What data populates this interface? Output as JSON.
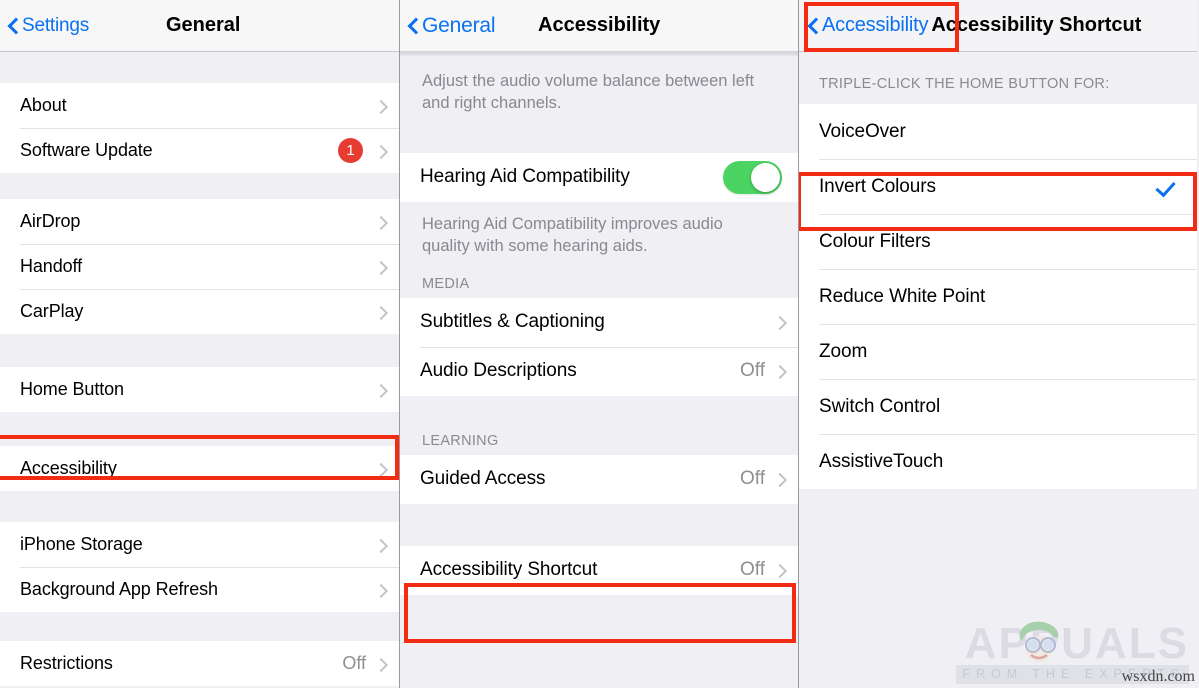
{
  "panel1": {
    "nav": {
      "back_label": "Settings",
      "title": "General",
      "back_icon": "chevron-left-icon"
    },
    "groups": [
      {
        "rows": [
          {
            "label": "About",
            "value": "",
            "accessory": "chevron"
          },
          {
            "label": "Software Update",
            "value": "",
            "badge": "1",
            "accessory": "chevron"
          }
        ]
      },
      {
        "rows": [
          {
            "label": "AirDrop",
            "value": "",
            "accessory": "chevron"
          },
          {
            "label": "Handoff",
            "value": "",
            "accessory": "chevron"
          },
          {
            "label": "CarPlay",
            "value": "",
            "accessory": "chevron"
          }
        ]
      },
      {
        "rows": [
          {
            "label": "Home Button",
            "value": "",
            "accessory": "chevron"
          }
        ]
      },
      {
        "rows": [
          {
            "label": "Accessibility",
            "value": "",
            "accessory": "chevron",
            "highlighted": true
          }
        ]
      },
      {
        "rows": [
          {
            "label": "iPhone Storage",
            "value": "",
            "accessory": "chevron"
          },
          {
            "label": "Background App Refresh",
            "value": "",
            "accessory": "chevron"
          }
        ]
      },
      {
        "rows": [
          {
            "label": "Restrictions",
            "value": "Off",
            "accessory": "chevron"
          }
        ]
      }
    ]
  },
  "panel2": {
    "nav": {
      "back_label": "General",
      "title": "Accessibility",
      "back_icon": "chevron-left-icon"
    },
    "note_top": "Adjust the audio volume balance between left and right channels.",
    "hearing_aid": {
      "label": "Hearing Aid Compatibility",
      "toggle_on": true,
      "toggle_color": "#4cd462"
    },
    "note_hearing": "Hearing Aid Compatibility improves audio quality with some hearing aids.",
    "media_header": "MEDIA",
    "media_rows": [
      {
        "label": "Subtitles & Captioning",
        "value": "",
        "accessory": "chevron"
      },
      {
        "label": "Audio Descriptions",
        "value": "Off",
        "accessory": "chevron"
      }
    ],
    "learning_header": "LEARNING",
    "learning_rows": [
      {
        "label": "Guided Access",
        "value": "Off",
        "accessory": "chevron"
      }
    ],
    "shortcut_row": {
      "label": "Accessibility Shortcut",
      "value": "Off",
      "accessory": "chevron",
      "highlighted": true
    }
  },
  "panel3": {
    "nav": {
      "back_label": "Accessibility",
      "title": "Accessibility Shortcut",
      "back_icon": "chevron-left-icon",
      "back_highlighted": true
    },
    "section_header": "TRIPLE-CLICK THE HOME BUTTON FOR:",
    "options": [
      {
        "label": "VoiceOver",
        "selected": false
      },
      {
        "label": "Invert Colours",
        "selected": true,
        "highlighted": true
      },
      {
        "label": "Colour Filters",
        "selected": false
      },
      {
        "label": "Reduce White Point",
        "selected": false
      },
      {
        "label": "Zoom",
        "selected": false
      },
      {
        "label": "Switch Control",
        "selected": false
      },
      {
        "label": "AssistiveTouch",
        "selected": false
      }
    ],
    "check_icon": "checkmark-icon",
    "check_color": "#0a71f2"
  },
  "watermark": {
    "brand": "APPUALS",
    "tagline": "FROM THE EXPERTS",
    "site": "wsxdn.com"
  },
  "colors": {
    "accent_blue": "#0a71f2",
    "highlight_red": "#f42b13",
    "badge_red": "#e63c32",
    "toggle_green": "#4cd462",
    "group_bg": "#ffffff",
    "page_bg": "#efeff4"
  }
}
